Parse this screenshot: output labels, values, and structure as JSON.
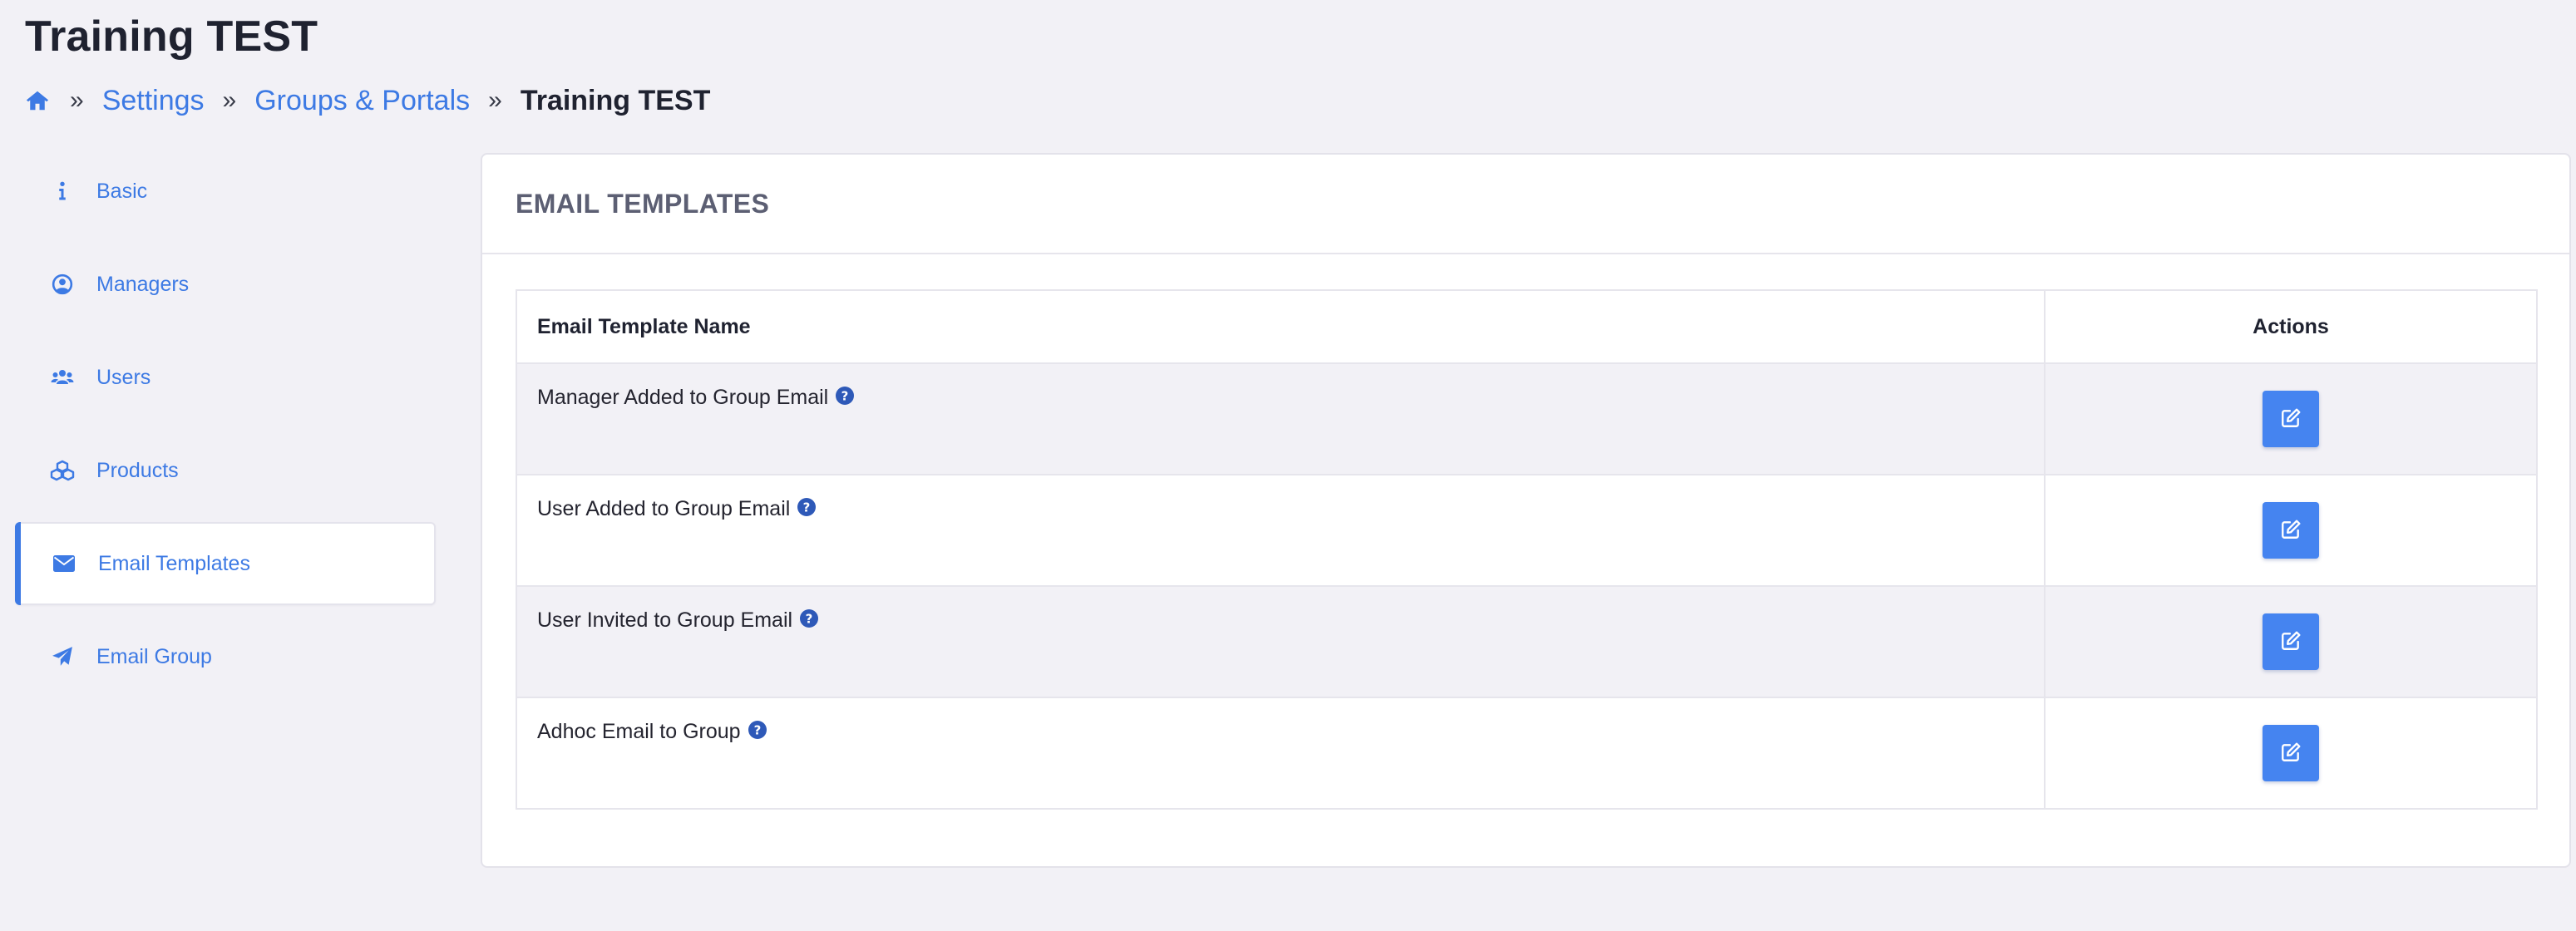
{
  "page": {
    "title": "Training TEST"
  },
  "breadcrumb": {
    "home_icon": "home-icon",
    "separator": "»",
    "items": [
      "Settings",
      "Groups & Portals"
    ],
    "current": "Training TEST"
  },
  "sidebar": {
    "items": [
      {
        "label": "Basic",
        "icon": "info-icon",
        "active": false
      },
      {
        "label": "Managers",
        "icon": "user-circle-icon",
        "active": false
      },
      {
        "label": "Users",
        "icon": "users-icon",
        "active": false
      },
      {
        "label": "Products",
        "icon": "cubes-icon",
        "active": false
      },
      {
        "label": "Email Templates",
        "icon": "envelope-icon",
        "active": true
      },
      {
        "label": "Email Group",
        "icon": "paper-plane-icon",
        "active": false
      }
    ]
  },
  "main": {
    "card_title": "EMAIL TEMPLATES",
    "table": {
      "columns": [
        "Email Template Name",
        "Actions"
      ],
      "rows": [
        {
          "name": "Manager Added to Group Email",
          "help_icon": "question-circle-icon",
          "action_icon": "edit-icon"
        },
        {
          "name": "User Added to Group Email",
          "help_icon": "question-circle-icon",
          "action_icon": "edit-icon"
        },
        {
          "name": "User Invited to Group Email",
          "help_icon": "question-circle-icon",
          "action_icon": "edit-icon"
        },
        {
          "name": "Adhoc Email to Group",
          "help_icon": "question-circle-icon",
          "action_icon": "edit-icon"
        }
      ]
    }
  },
  "colors": {
    "accent": "#3d7ae4",
    "button": "#4584f0",
    "help_icon": "#2e59b8",
    "page_bg": "#f2f1f6"
  }
}
